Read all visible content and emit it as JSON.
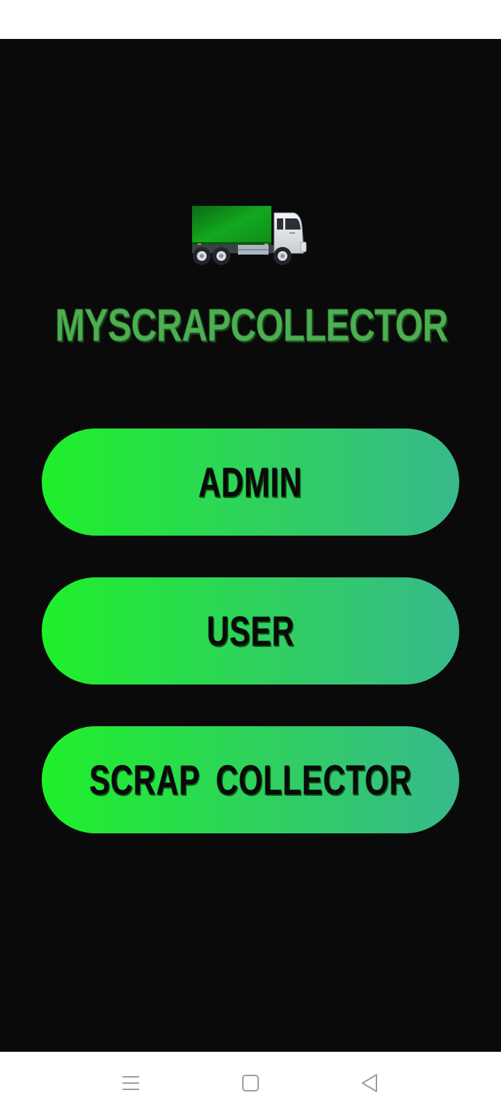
{
  "app": {
    "title": "MYSCRAPCOLLECTOR",
    "logo_icon": "truck-icon"
  },
  "buttons": {
    "admin_label": "ADMIN",
    "user_label": "USER",
    "collector_label": "SCRAP COLLECTOR"
  },
  "colors": {
    "background": "#0a0a0a",
    "title_green": "#4caf50",
    "button_gradient_start": "#1ff02a",
    "button_gradient_end": "#38b98c"
  },
  "navigation": {
    "icons": [
      "menu-icon",
      "home-icon",
      "back-icon"
    ]
  }
}
